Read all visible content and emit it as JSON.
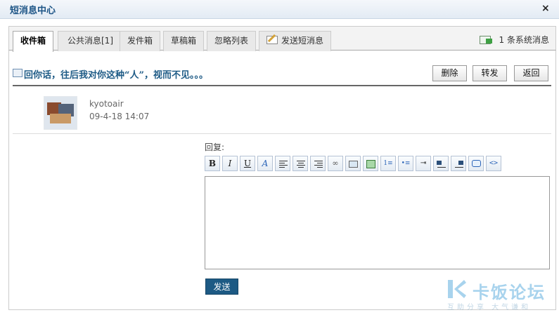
{
  "window": {
    "title": "短消息中心",
    "close_label": "×"
  },
  "tabs": [
    {
      "label": "收件箱",
      "active": true
    },
    {
      "label": "公共消息[1]"
    },
    {
      "label": "发件箱"
    },
    {
      "label": "草稿箱"
    },
    {
      "label": "忽略列表"
    },
    {
      "label": "发送短消息",
      "icon": "compose-icon"
    }
  ],
  "system_messages": {
    "count": "1",
    "label": "条系统消息",
    "icon": "system-message-icon"
  },
  "message": {
    "subject": "回你话，往后我对你这种“人”，视而不见。。。",
    "sender": "kyotoair",
    "time": "09-4-18 14:07",
    "actions": {
      "delete": "删除",
      "forward": "转发",
      "back": "返回"
    }
  },
  "reply": {
    "label": "回复:",
    "send_label": "发送",
    "content": "",
    "toolbar": [
      "bold",
      "italic",
      "underline",
      "font-color",
      "align-left",
      "align-center",
      "align-right",
      "link",
      "image",
      "media",
      "ordered-list",
      "unordered-list",
      "indent",
      "float-left",
      "float-right",
      "quote",
      "code"
    ]
  },
  "watermark": {
    "brand": "卡饭论坛",
    "tagline": "互助分享  大气谦和"
  },
  "colors": {
    "title": "#1c5486",
    "subject": "#1e5b86",
    "send_button": "#1d5a84"
  }
}
